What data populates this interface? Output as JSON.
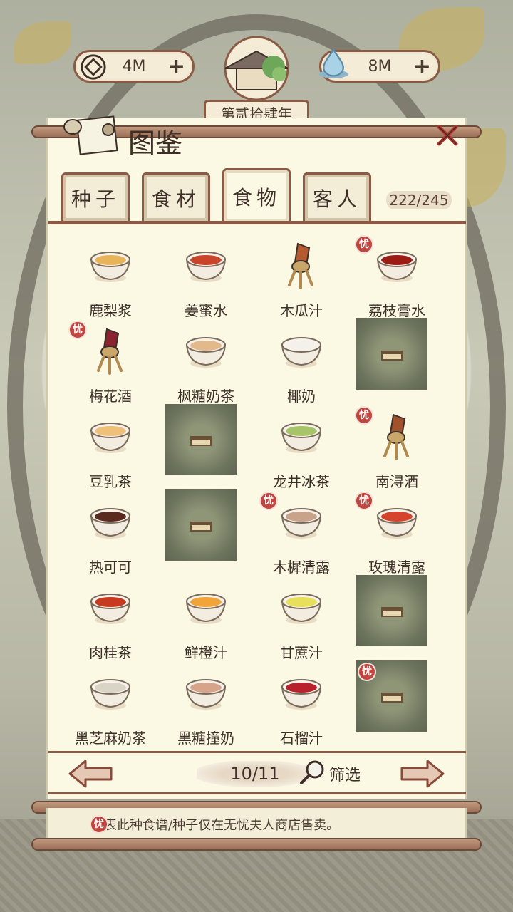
{
  "resources": {
    "coins": {
      "value": "4M",
      "icon": "coin-icon",
      "plus": "+"
    },
    "water": {
      "value": "8M",
      "icon": "water-drop-icon",
      "plus": "+"
    }
  },
  "year": "第贰拾肆年",
  "panel": {
    "title": "图鉴",
    "close": "✕"
  },
  "tabs": [
    {
      "label": "种子",
      "active": false
    },
    {
      "label": "食材",
      "active": false
    },
    {
      "label": "食物",
      "active": true
    },
    {
      "label": "客人",
      "active": false
    }
  ],
  "count": "222/245",
  "items": [
    {
      "name": "鹿梨浆",
      "icon": "cup-light-orange",
      "color": "#e9b35a",
      "locked": false,
      "exclusive": false
    },
    {
      "name": "姜蜜水",
      "icon": "cup-red-orange",
      "color": "#c8452a",
      "locked": false,
      "exclusive": false
    },
    {
      "name": "木瓜汁",
      "icon": "wine-vessel",
      "color": "#b55a2e",
      "locked": false,
      "exclusive": false
    },
    {
      "name": "荔枝膏水",
      "icon": "cup-dark-red",
      "color": "#9b1c14",
      "locked": false,
      "exclusive": true
    },
    {
      "name": "梅花酒",
      "icon": "wine-vessel",
      "color": "#8b2230",
      "locked": false,
      "exclusive": true
    },
    {
      "name": "枫糖奶茶",
      "icon": "cup-milk-tea",
      "color": "#e3b98c",
      "locked": false,
      "exclusive": false
    },
    {
      "name": "椰奶",
      "icon": "cup-white",
      "color": "#f4f1ea",
      "locked": false,
      "exclusive": false
    },
    {
      "name": "",
      "icon": "locked-slot",
      "color": "",
      "locked": true,
      "exclusive": false
    },
    {
      "name": "豆乳茶",
      "icon": "cup-soy-tea",
      "color": "#eec07a",
      "locked": false,
      "exclusive": false
    },
    {
      "name": "",
      "icon": "locked-slot",
      "color": "",
      "locked": true,
      "exclusive": false
    },
    {
      "name": "龙井冰茶",
      "icon": "cup-green-tea",
      "color": "#a8c46a",
      "locked": false,
      "exclusive": false
    },
    {
      "name": "南浔酒",
      "icon": "wine-vessel",
      "color": "#a0522d",
      "locked": false,
      "exclusive": true
    },
    {
      "name": "热可可",
      "icon": "cup-cocoa",
      "color": "#5a2a1e",
      "locked": false,
      "exclusive": false
    },
    {
      "name": "",
      "icon": "locked-slot",
      "color": "",
      "locked": true,
      "exclusive": false
    },
    {
      "name": "木樨清露",
      "icon": "cup-osmanthus",
      "color": "#c9a28a",
      "locked": false,
      "exclusive": true
    },
    {
      "name": "玫瑰清露",
      "icon": "cup-rose",
      "color": "#d6432c",
      "locked": false,
      "exclusive": true
    },
    {
      "name": "肉桂茶",
      "icon": "cup-cinnamon",
      "color": "#c73a1f",
      "locked": false,
      "exclusive": false
    },
    {
      "name": "鲜橙汁",
      "icon": "cup-orange",
      "color": "#f0a43a",
      "locked": false,
      "exclusive": false
    },
    {
      "name": "甘蔗汁",
      "icon": "cup-yellow",
      "color": "#e8e05a",
      "locked": false,
      "exclusive": false
    },
    {
      "name": "",
      "icon": "locked-slot",
      "color": "",
      "locked": true,
      "exclusive": false
    },
    {
      "name": "黑芝麻奶茶",
      "icon": "cup-sesame",
      "color": "#d9d4c6",
      "locked": false,
      "exclusive": false
    },
    {
      "name": "黑糖撞奶",
      "icon": "cup-brown-sugar",
      "color": "#d7a48a",
      "locked": false,
      "exclusive": false
    },
    {
      "name": "石榴汁",
      "icon": "cup-pomegranate",
      "color": "#b8202c",
      "locked": false,
      "exclusive": false
    },
    {
      "name": "",
      "icon": "locked-slot",
      "color": "",
      "locked": true,
      "exclusive": true
    }
  ],
  "pager": {
    "page": "10/11",
    "filter": "筛选"
  },
  "note": "代表此种食谱/种子仅在无忧夫人商店售卖。",
  "exclusive_mark": "忧"
}
